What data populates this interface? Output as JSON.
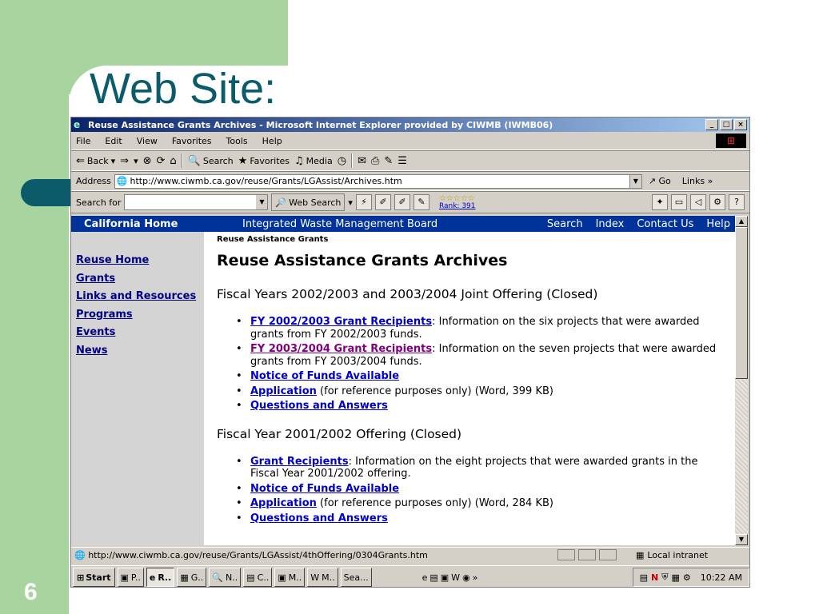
{
  "slide": {
    "title": "Web Site:",
    "number": "6"
  },
  "window": {
    "title": "Reuse Assistance Grants Archives - Microsoft Internet Explorer provided by CIWMB (IWMB06)",
    "min": "_",
    "max": "□",
    "close": "×"
  },
  "menu": [
    "File",
    "Edit",
    "View",
    "Favorites",
    "Tools",
    "Help"
  ],
  "toolbar": {
    "back": "Back",
    "search": "Search",
    "favorites": "Favorites",
    "media": "Media"
  },
  "address": {
    "label": "Address",
    "url": "http://www.ciwmb.ca.gov/reuse/Grants/LGAssist/Archives.htm",
    "go": "Go",
    "links": "Links"
  },
  "searchbar": {
    "label": "Search for",
    "web_search": "Web Search",
    "rank_stars": "☆☆☆☆☆",
    "rank": "Rank: 391"
  },
  "nav": {
    "home": "California Home",
    "board": "Integrated Waste Management Board",
    "search": "Search",
    "index": "Index",
    "contact": "Contact Us",
    "help": "Help"
  },
  "sidebar": {
    "items": [
      "Reuse Home",
      "Grants",
      "Links and Resources",
      "Programs",
      "Events",
      "News"
    ]
  },
  "main": {
    "breadcrumb": "Reuse Assistance Grants",
    "heading": "Reuse Assistance Grants Archives",
    "section1": {
      "title": "Fiscal Years 2002/2003 and 2003/2004 Joint Offering (Closed)",
      "item1_link": "FY 2002/2003 Grant Recipients",
      "item1_text": ": Information on the six projects that were awarded grants from FY 2002/2003 funds.",
      "item2_link": "FY 2003/2004 Grant Recipients",
      "item2_text": ": Information on the seven projects that were awarded grants from FY 2003/2004 funds.",
      "item3_link": "Notice of Funds Available",
      "item4_link": "Application",
      "item4_text": " (for reference purposes only) (Word, 399 KB)",
      "item5_link": "Questions and Answers"
    },
    "section2": {
      "title": "Fiscal Year 2001/2002 Offering (Closed)",
      "item1_link": "Grant Recipients",
      "item1_text": ": Information on the eight projects that were awarded grants in the Fiscal Year 2001/2002 offering.",
      "item2_link": "Notice of Funds Available",
      "item3_link": "Application",
      "item3_text": " (for reference purposes only) (Word, 284 KB)",
      "item4_link": "Questions and Answers"
    }
  },
  "status": {
    "url": "http://www.ciwmb.ca.gov/reuse/Grants/LGAssist/4thOffering/0304Grants.htm",
    "zone": "Local intranet"
  },
  "taskbar": {
    "start": "Start",
    "buttons": [
      "P..",
      "R..",
      "G..",
      "N..",
      "C..",
      "M..",
      "M..",
      "Sea..."
    ],
    "clock": "10:22 AM"
  }
}
